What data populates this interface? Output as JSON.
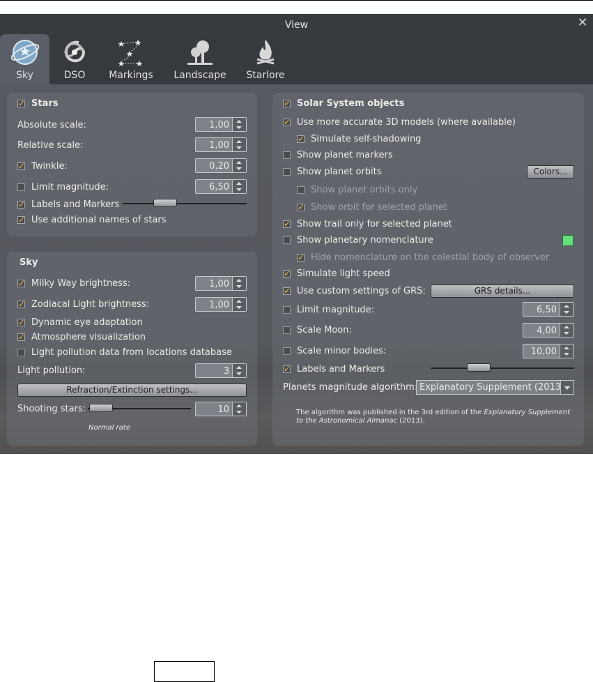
{
  "window": {
    "title": "View"
  },
  "tabs": [
    {
      "label": "Sky",
      "icon": "sky-icon"
    },
    {
      "label": "DSO",
      "icon": "galaxy-icon"
    },
    {
      "label": "Markings",
      "icon": "constellation-icon"
    },
    {
      "label": "Landscape",
      "icon": "tree-icon"
    },
    {
      "label": "Starlore",
      "icon": "fire-icon"
    }
  ],
  "stars": {
    "header": "Stars",
    "absolute_scale_label": "Absolute scale:",
    "absolute_scale": "1,00",
    "relative_scale_label": "Relative scale:",
    "relative_scale": "1,00",
    "twinkle_label": "Twinkle:",
    "twinkle": "0,20",
    "limit_magnitude_label": "Limit magnitude:",
    "limit_magnitude": "6,50",
    "labels_label": "Labels and Markers",
    "labels_level": 0.35,
    "additional_names_label": "Use additional names of stars"
  },
  "sky": {
    "header": "Sky",
    "milky_way_label": "Milky Way brightness:",
    "milky_way": "1,00",
    "zodiacal_label": "Zodiacal Light brightness:",
    "zodiacal": "1,00",
    "eye_adaptation_label": "Dynamic eye adaptation",
    "atmosphere_label": "Atmosphere visualization",
    "light_pollution_db_label": "Light pollution data from locations database",
    "light_pollution_label": "Light pollution:",
    "light_pollution": "3",
    "refraction_button": "Refraction/Extinction settings...",
    "shooting_stars_label": "Shooting stars:",
    "shooting_stars": "10",
    "shooting_rate": "Normal rate",
    "shooting_level": 0.0
  },
  "solar": {
    "header": "Solar System objects",
    "models_label": "Use more accurate 3D models (where available)",
    "self_shadow_label": "Simulate self-shadowing",
    "planet_markers_label": "Show planet markers",
    "planet_orbits_label": "Show planet orbits",
    "colors_button": "Colors...",
    "orbits_only_label": "Show planet orbits only",
    "orbit_selected_label": "Show orbit for selected planet",
    "trail_label": "Show trail only for selected planet",
    "nomenclature_label": "Show planetary nomenclature",
    "nomenclature_color": "#64e07c",
    "hide_nomenclature_label": "Hide nomenclature on the celestial body of observer",
    "light_speed_label": "Simulate light speed",
    "grs_label": "Use custom settings of GRS:",
    "grs_button": "GRS details...",
    "limit_magnitude_label": "Limit magnitude:",
    "limit_magnitude": "6,50",
    "scale_moon_label": "Scale Moon:",
    "scale_moon": "4,00",
    "scale_minor_label": "Scale minor bodies:",
    "scale_minor": "10,00",
    "labels_label": "Labels and Markers",
    "labels_level": 0.35,
    "algorithm_label": "Planets magnitude algorithm:",
    "algorithm_value": "Explanatory Supplement (2013)",
    "note_pre": "The algorithm was published in the 3rd edition of the ",
    "note_italic": "Explanatory Supplement to the Astronomical Almanac",
    "note_post": " (2013)."
  }
}
